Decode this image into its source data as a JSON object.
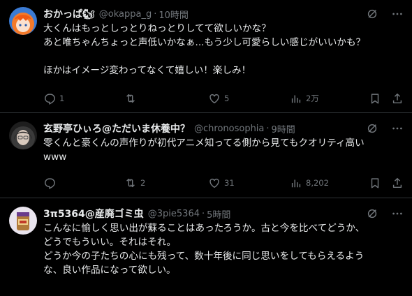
{
  "posts": [
    {
      "display_name": "おかっぱ🐿",
      "handle": "@okappa_g",
      "separator": "·",
      "time": "10時間",
      "text": "大くんはもっとしっとりねっとりしてて欲しいかな？\nあと唯ちゃんちょっと声低いかなぁ...もう少し可愛らしい感じがいいかも？\n\nほかはイメージ変わってなくて嬉しい！楽しみ！",
      "replies": "1",
      "reposts": "",
      "likes": "5",
      "views": "2万",
      "avatar_icon": "orange-hair-avatar"
    },
    {
      "display_name": "玄野亭ひぃろ@ただいま休養中？",
      "handle": "@chronosophia",
      "separator": "·",
      "time": "9時間",
      "text": "零くんと豪くんの声作りが初代アニメ知ってる側から見てもクオリティ高い\nwww",
      "replies": "",
      "reposts": "2",
      "likes": "31",
      "views": "8,202",
      "avatar_icon": "dark-hair-avatar"
    },
    {
      "display_name": "3π5364@産廃ゴミ虫",
      "handle": "@3pie5364",
      "separator": "·",
      "time": "5時間",
      "text": "こんなに愉しく思い出が蘇ることはあったろうか。古と今を比べてどうか、\nどうでもういい。それはそれ。\nどうか今の子たちの心にも残って、数十年後に同じ思いをしてもらえるよう\nな、良い作品になって欲しい。",
      "replies": "",
      "reposts": "",
      "likes": "",
      "views": "",
      "avatar_icon": "cup-avatar"
    }
  ],
  "colors": {
    "background": "#000000",
    "text": "#e7e9ea",
    "muted": "#71767b",
    "divider": "#2f3336"
  }
}
